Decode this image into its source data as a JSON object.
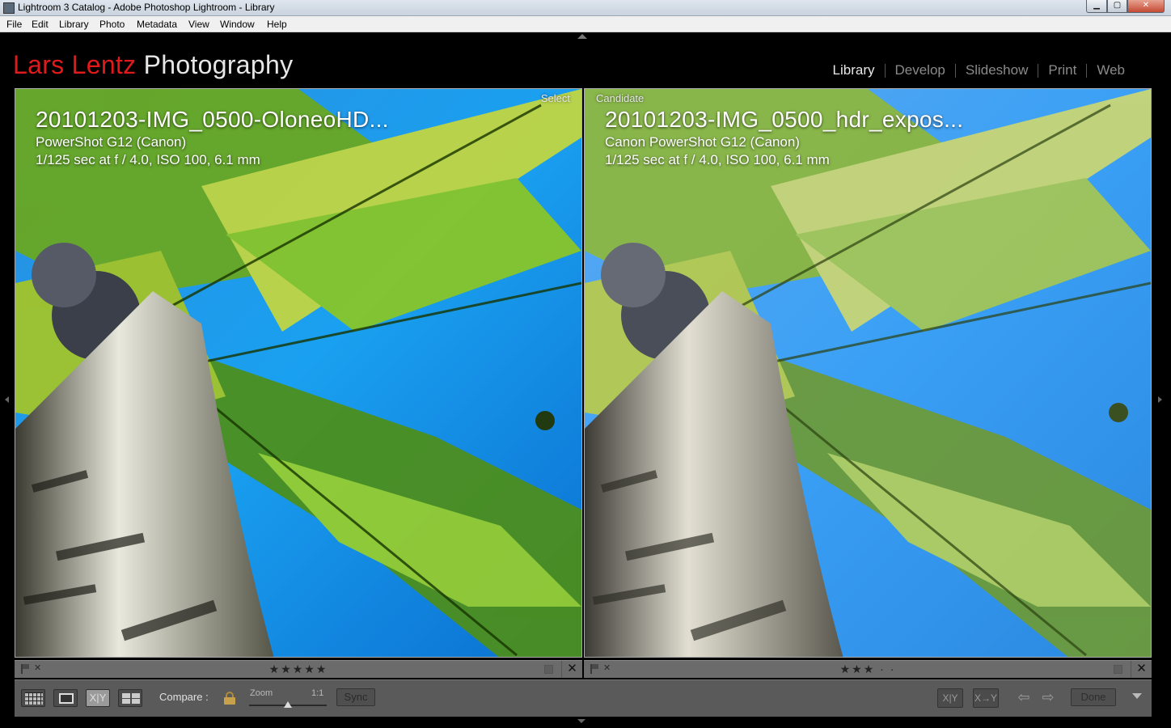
{
  "window": {
    "title": "Lightroom 3 Catalog - Adobe Photoshop Lightroom - Library",
    "controls": {
      "minimize": "▁",
      "maximize": "▢",
      "close": "✕"
    }
  },
  "menu": [
    "File",
    "Edit",
    "Library",
    "Photo",
    "Metadata",
    "View",
    "Window",
    "Help"
  ],
  "identity": {
    "first": "Lars Lentz",
    "second": "Photography",
    "colors": {
      "first": "#e01a1a",
      "second": "#e6e6e6"
    }
  },
  "modules": [
    {
      "label": "Library",
      "active": true
    },
    {
      "label": "Develop",
      "active": false
    },
    {
      "label": "Slideshow",
      "active": false
    },
    {
      "label": "Print",
      "active": false
    },
    {
      "label": "Web",
      "active": false
    }
  ],
  "photos": {
    "select": {
      "tag": "Select",
      "filename": "20101203-IMG_0500-OloneoHD...",
      "camera": "PowerShot G12 (Canon)",
      "exposure": "1/125 sec at f / 4.0, ISO 100, 6.1 mm",
      "rating": "★★★★★"
    },
    "candidate": {
      "tag": "Candidate",
      "filename": "20101203-IMG_0500_hdr_expos...",
      "camera": "Canon PowerShot G12 (Canon)",
      "exposure": "1/125 sec at f / 4.0, ISO 100, 6.1 mm",
      "rating": "★★★ · ·"
    }
  },
  "toolbar": {
    "xy_label": "X|Y",
    "compare_label": "Compare :",
    "zoom_label": "Zoom",
    "zoom_value": "1:1",
    "sync_label": "Sync",
    "swap_label": "X|Y",
    "make_select_label": "X→Y",
    "prev_arrow": "⇦",
    "next_arrow": "⇨",
    "done_label": "Done",
    "close_glyph": "✕",
    "flag_x": "✕"
  }
}
